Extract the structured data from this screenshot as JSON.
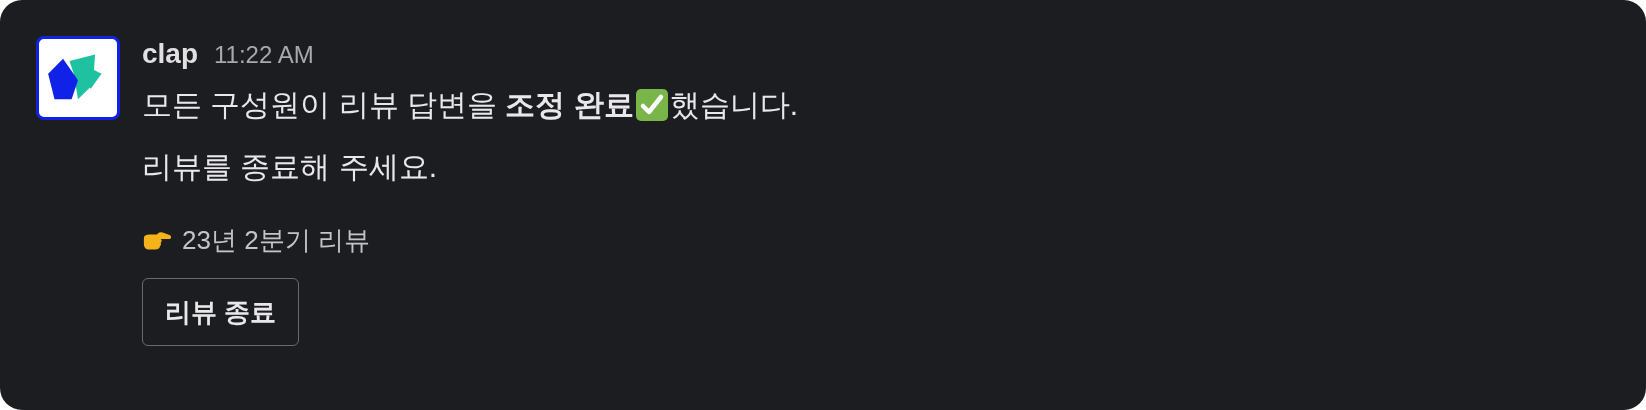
{
  "message": {
    "author": "clap",
    "time": "11:22 AM",
    "text_before_check": "모든 구성원이 리뷰 답변을 **조정 완료**",
    "text_after_check": "했습니다.",
    "text_line_2": "리뷰를 종료해 주세요.",
    "link": "23년 2분기 리뷰",
    "button": "리뷰 종료"
  }
}
